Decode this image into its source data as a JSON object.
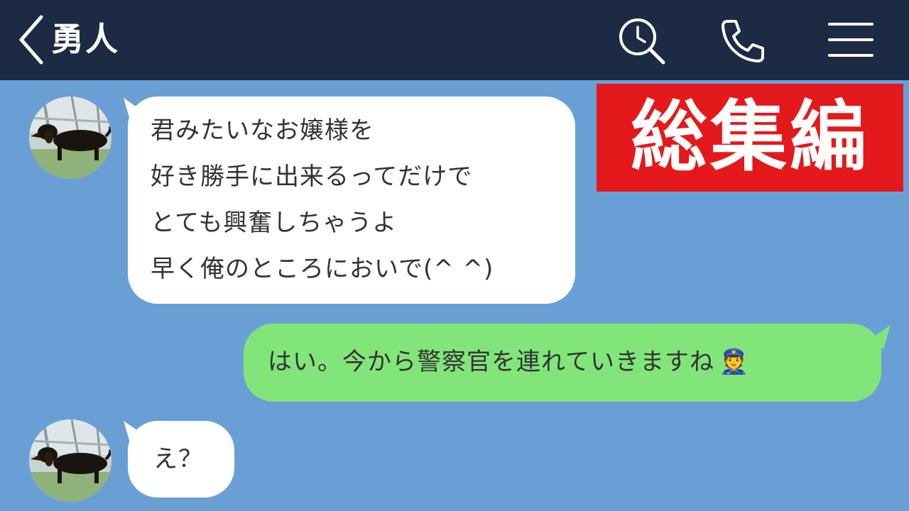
{
  "header": {
    "back_icon": "chevron-left-icon",
    "title": "勇人",
    "icons": [
      "search-icon",
      "phone-icon",
      "menu-icon"
    ]
  },
  "banner": {
    "text": "総集編",
    "color": "#e3191b"
  },
  "messages": [
    {
      "side": "left",
      "avatar": "dachshund-avatar",
      "lines": [
        "君みたいなお嬢様を",
        "好き勝手に出来るってだけで",
        "とても興奮しちゃうよ",
        "早く俺のところにおいで(^ ^)"
      ]
    },
    {
      "side": "right",
      "text": "はい。今から警察官を連れていきますね",
      "emoji": "👮"
    },
    {
      "side": "left",
      "avatar": "dachshund-avatar",
      "text": "え？"
    }
  ],
  "colors": {
    "header": "#1d2a44",
    "chat_background": "#6a9fd6",
    "incoming_bubble": "#ffffff",
    "outgoing_bubble": "#82e57a"
  }
}
